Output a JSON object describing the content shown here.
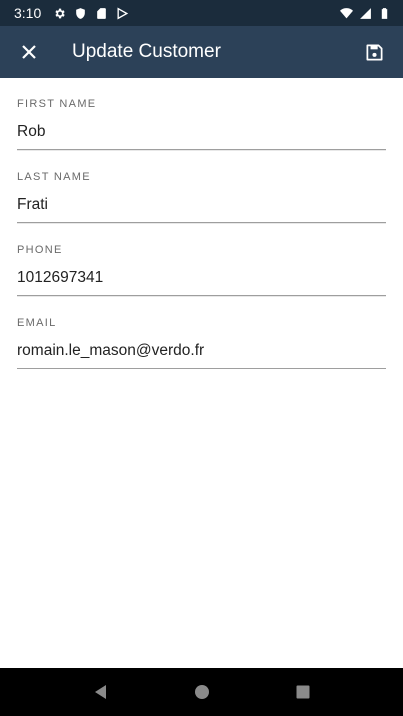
{
  "status_bar": {
    "time": "3:10",
    "left_icons": [
      "settings-icon",
      "shield-icon",
      "sd-card-icon",
      "play-store-icon"
    ],
    "right_icons": [
      "wifi-icon",
      "signal-icon",
      "battery-icon"
    ]
  },
  "app_bar": {
    "title": "Update Customer",
    "close_icon": "close-icon",
    "save_icon": "save-icon",
    "background": "#2c4158"
  },
  "form": {
    "fields": [
      {
        "label": "FIRST NAME",
        "value": "Rob"
      },
      {
        "label": "LAST NAME",
        "value": "Frati"
      },
      {
        "label": "PHONE",
        "value": "1012697341"
      },
      {
        "label": "EMAIL",
        "value": "romain.le_mason@verdo.fr"
      }
    ]
  },
  "nav_bar": {
    "icons": [
      "back-icon",
      "home-icon",
      "recents-icon"
    ]
  }
}
